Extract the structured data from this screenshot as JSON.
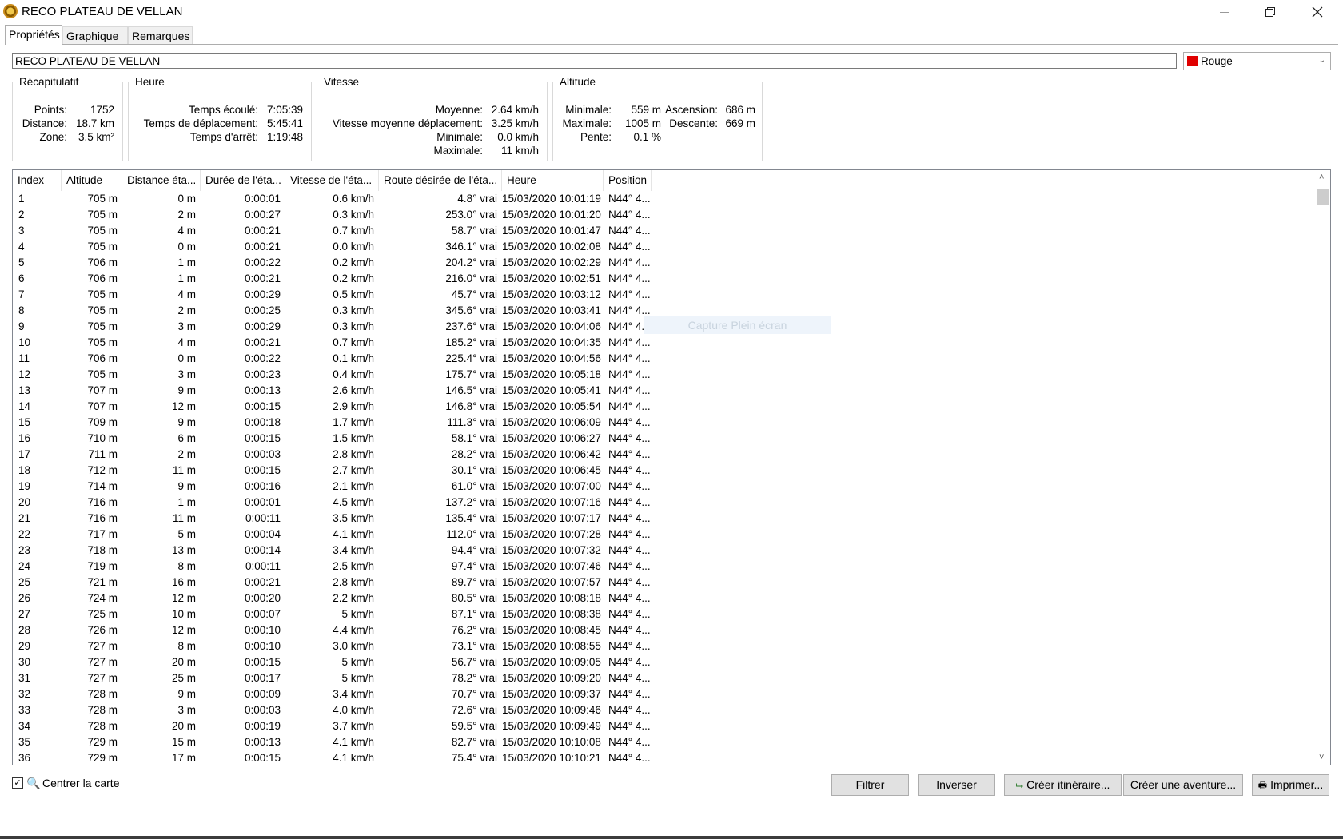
{
  "window": {
    "title": "RECO PLATEAU DE VELLAN"
  },
  "tabs": [
    "Propriétés",
    "Graphique",
    "Remarques"
  ],
  "name_value": "RECO PLATEAU DE VELLAN",
  "color": {
    "label": "Rouge",
    "swatch": "#e00000"
  },
  "groups": {
    "recap": {
      "title": "Récapitulatif",
      "rows": [
        {
          "label": "Points:",
          "value": "1752"
        },
        {
          "label": "Distance:",
          "value": "18.7 km"
        },
        {
          "label": "Zone:",
          "value": "3.5 km²"
        }
      ]
    },
    "heure": {
      "title": "Heure",
      "rows": [
        {
          "label": "Temps écoulé:",
          "value": "7:05:39"
        },
        {
          "label": "Temps de déplacement:",
          "value": "5:45:41"
        },
        {
          "label": "Temps d'arrêt:",
          "value": "1:19:48"
        }
      ]
    },
    "vitesse": {
      "title": "Vitesse",
      "rows": [
        {
          "label": "Moyenne:",
          "value": "2.64 km/h"
        },
        {
          "label": "Vitesse moyenne déplacement:",
          "value": "3.25 km/h"
        },
        {
          "label": "Minimale:",
          "value": "0.0 km/h"
        },
        {
          "label": "Maximale:",
          "value": "11 km/h"
        }
      ]
    },
    "altitude": {
      "title": "Altitude",
      "rows": [
        {
          "label": "Minimale:",
          "value": "559 m",
          "label2": "Ascension:",
          "value2": "686 m"
        },
        {
          "label": "Maximale:",
          "value": "1005 m",
          "label2": "Descente:",
          "value2": "669 m"
        },
        {
          "label": "Pente:",
          "value": "0.1 %"
        }
      ]
    }
  },
  "table": {
    "headers": [
      "Index",
      "Altitude",
      "Distance éta...",
      "Durée de l'éta...",
      "Vitesse de l'éta...",
      "Route désirée de l'éta...",
      "Heure",
      "Position"
    ],
    "rows": [
      [
        "1",
        "705 m",
        "0 m",
        "0:00:01",
        "0.6 km/h",
        "4.8° vrai",
        "15/03/2020 10:01:19",
        "N44° 4..."
      ],
      [
        "2",
        "705 m",
        "2 m",
        "0:00:27",
        "0.3 km/h",
        "253.0° vrai",
        "15/03/2020 10:01:20",
        "N44° 4..."
      ],
      [
        "3",
        "705 m",
        "4 m",
        "0:00:21",
        "0.7 km/h",
        "58.7° vrai",
        "15/03/2020 10:01:47",
        "N44° 4..."
      ],
      [
        "4",
        "705 m",
        "0 m",
        "0:00:21",
        "0.0 km/h",
        "346.1° vrai",
        "15/03/2020 10:02:08",
        "N44° 4..."
      ],
      [
        "5",
        "706 m",
        "1 m",
        "0:00:22",
        "0.2 km/h",
        "204.2° vrai",
        "15/03/2020 10:02:29",
        "N44° 4..."
      ],
      [
        "6",
        "706 m",
        "1 m",
        "0:00:21",
        "0.2 km/h",
        "216.0° vrai",
        "15/03/2020 10:02:51",
        "N44° 4..."
      ],
      [
        "7",
        "705 m",
        "4 m",
        "0:00:29",
        "0.5 km/h",
        "45.7° vrai",
        "15/03/2020 10:03:12",
        "N44° 4..."
      ],
      [
        "8",
        "705 m",
        "2 m",
        "0:00:25",
        "0.3 km/h",
        "345.6° vrai",
        "15/03/2020 10:03:41",
        "N44° 4..."
      ],
      [
        "9",
        "705 m",
        "3 m",
        "0:00:29",
        "0.3 km/h",
        "237.6° vrai",
        "15/03/2020 10:04:06",
        "N44° 4..."
      ],
      [
        "10",
        "705 m",
        "4 m",
        "0:00:21",
        "0.7 km/h",
        "185.2° vrai",
        "15/03/2020 10:04:35",
        "N44° 4..."
      ],
      [
        "11",
        "706 m",
        "0 m",
        "0:00:22",
        "0.1 km/h",
        "225.4° vrai",
        "15/03/2020 10:04:56",
        "N44° 4..."
      ],
      [
        "12",
        "705 m",
        "3 m",
        "0:00:23",
        "0.4 km/h",
        "175.7° vrai",
        "15/03/2020 10:05:18",
        "N44° 4..."
      ],
      [
        "13",
        "707 m",
        "9 m",
        "0:00:13",
        "2.6 km/h",
        "146.5° vrai",
        "15/03/2020 10:05:41",
        "N44° 4..."
      ],
      [
        "14",
        "707 m",
        "12 m",
        "0:00:15",
        "2.9 km/h",
        "146.8° vrai",
        "15/03/2020 10:05:54",
        "N44° 4..."
      ],
      [
        "15",
        "709 m",
        "9 m",
        "0:00:18",
        "1.7 km/h",
        "111.3° vrai",
        "15/03/2020 10:06:09",
        "N44° 4..."
      ],
      [
        "16",
        "710 m",
        "6 m",
        "0:00:15",
        "1.5 km/h",
        "58.1° vrai",
        "15/03/2020 10:06:27",
        "N44° 4..."
      ],
      [
        "17",
        "711 m",
        "2 m",
        "0:00:03",
        "2.8 km/h",
        "28.2° vrai",
        "15/03/2020 10:06:42",
        "N44° 4..."
      ],
      [
        "18",
        "712 m",
        "11 m",
        "0:00:15",
        "2.7 km/h",
        "30.1° vrai",
        "15/03/2020 10:06:45",
        "N44° 4..."
      ],
      [
        "19",
        "714 m",
        "9 m",
        "0:00:16",
        "2.1 km/h",
        "61.0° vrai",
        "15/03/2020 10:07:00",
        "N44° 4..."
      ],
      [
        "20",
        "716 m",
        "1 m",
        "0:00:01",
        "4.5 km/h",
        "137.2° vrai",
        "15/03/2020 10:07:16",
        "N44° 4..."
      ],
      [
        "21",
        "716 m",
        "11 m",
        "0:00:11",
        "3.5 km/h",
        "135.4° vrai",
        "15/03/2020 10:07:17",
        "N44° 4..."
      ],
      [
        "22",
        "717 m",
        "5 m",
        "0:00:04",
        "4.1 km/h",
        "112.0° vrai",
        "15/03/2020 10:07:28",
        "N44° 4..."
      ],
      [
        "23",
        "718 m",
        "13 m",
        "0:00:14",
        "3.4 km/h",
        "94.4° vrai",
        "15/03/2020 10:07:32",
        "N44° 4..."
      ],
      [
        "24",
        "719 m",
        "8 m",
        "0:00:11",
        "2.5 km/h",
        "97.4° vrai",
        "15/03/2020 10:07:46",
        "N44° 4..."
      ],
      [
        "25",
        "721 m",
        "16 m",
        "0:00:21",
        "2.8 km/h",
        "89.7° vrai",
        "15/03/2020 10:07:57",
        "N44° 4..."
      ],
      [
        "26",
        "724 m",
        "12 m",
        "0:00:20",
        "2.2 km/h",
        "80.5° vrai",
        "15/03/2020 10:08:18",
        "N44° 4..."
      ],
      [
        "27",
        "725 m",
        "10 m",
        "0:00:07",
        "5 km/h",
        "87.1° vrai",
        "15/03/2020 10:08:38",
        "N44° 4..."
      ],
      [
        "28",
        "726 m",
        "12 m",
        "0:00:10",
        "4.4 km/h",
        "76.2° vrai",
        "15/03/2020 10:08:45",
        "N44° 4..."
      ],
      [
        "29",
        "727 m",
        "8 m",
        "0:00:10",
        "3.0 km/h",
        "73.1° vrai",
        "15/03/2020 10:08:55",
        "N44° 4..."
      ],
      [
        "30",
        "727 m",
        "20 m",
        "0:00:15",
        "5 km/h",
        "56.7° vrai",
        "15/03/2020 10:09:05",
        "N44° 4..."
      ],
      [
        "31",
        "727 m",
        "25 m",
        "0:00:17",
        "5 km/h",
        "78.2° vrai",
        "15/03/2020 10:09:20",
        "N44° 4..."
      ],
      [
        "32",
        "728 m",
        "9 m",
        "0:00:09",
        "3.4 km/h",
        "70.7° vrai",
        "15/03/2020 10:09:37",
        "N44° 4..."
      ],
      [
        "33",
        "728 m",
        "3 m",
        "0:00:03",
        "4.0 km/h",
        "72.6° vrai",
        "15/03/2020 10:09:46",
        "N44° 4..."
      ],
      [
        "34",
        "728 m",
        "20 m",
        "0:00:19",
        "3.7 km/h",
        "59.5° vrai",
        "15/03/2020 10:09:49",
        "N44° 4..."
      ],
      [
        "35",
        "729 m",
        "15 m",
        "0:00:13",
        "4.1 km/h",
        "82.7° vrai",
        "15/03/2020 10:10:08",
        "N44° 4..."
      ],
      [
        "36",
        "729 m",
        "17 m",
        "0:00:15",
        "4.1 km/h",
        "75.4° vrai",
        "15/03/2020 10:10:21",
        "N44° 4..."
      ]
    ]
  },
  "overlay_text": "Capture Plein écran",
  "center_map": {
    "label": "Centrer la carte",
    "checked": true
  },
  "buttons": {
    "filter": "Filtrer",
    "invert": "Inverser",
    "create_route": "Créer itinéraire...",
    "create_adventure": "Créer une aventure...",
    "print": "Imprimer..."
  }
}
